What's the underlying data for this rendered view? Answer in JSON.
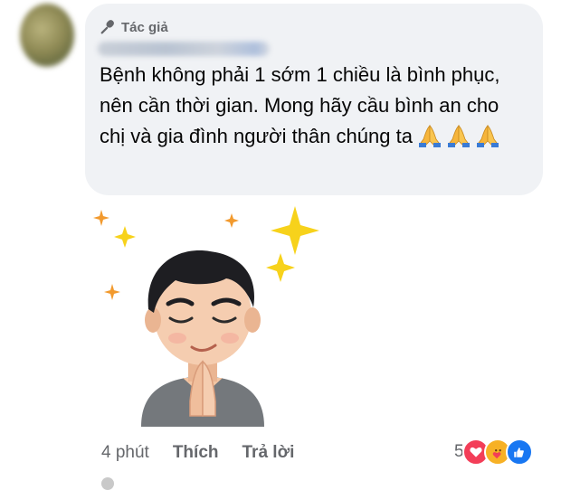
{
  "comment": {
    "author_badge": "Tác giả",
    "text": "Bệnh không phải 1 sớm 1 chiều là bình phục, nên cần thời gian. Mong hãy cầu bình an cho chị và gia đình người thân chúng ta",
    "emoji": [
      "folded-hands",
      "folded-hands",
      "folded-hands"
    ]
  },
  "sticker": {
    "icon": "praying-avatar-sticker",
    "sparkle_color": "#f7d21b"
  },
  "actions": {
    "time": "4 phút",
    "like_label": "Thích",
    "reply_label": "Trả lời"
  },
  "reactions": {
    "count": "5",
    "icons": [
      "love-icon",
      "care-icon",
      "like-icon"
    ],
    "colors": {
      "love": "#f33e58",
      "care": "#f7b125",
      "like": "#1877f2"
    }
  }
}
